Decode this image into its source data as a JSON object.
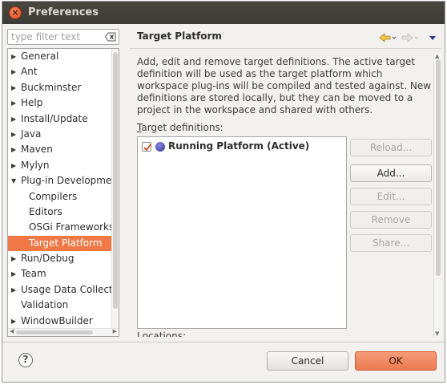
{
  "window": {
    "title": "Preferences"
  },
  "filter": {
    "placeholder": "type filter text"
  },
  "tree": {
    "items": [
      {
        "label": "General",
        "expanded": false,
        "child": false,
        "selected": false
      },
      {
        "label": "Ant",
        "expanded": false,
        "child": false,
        "selected": false
      },
      {
        "label": "Buckminster",
        "expanded": false,
        "child": false,
        "selected": false
      },
      {
        "label": "Help",
        "expanded": false,
        "child": false,
        "selected": false
      },
      {
        "label": "Install/Update",
        "expanded": false,
        "child": false,
        "selected": false
      },
      {
        "label": "Java",
        "expanded": false,
        "child": false,
        "selected": false
      },
      {
        "label": "Maven",
        "expanded": false,
        "child": false,
        "selected": false
      },
      {
        "label": "Mylyn",
        "expanded": false,
        "child": false,
        "selected": false
      },
      {
        "label": "Plug-in Developmen",
        "expanded": true,
        "child": false,
        "selected": false
      },
      {
        "label": "Compilers",
        "expanded": null,
        "child": true,
        "selected": false
      },
      {
        "label": "Editors",
        "expanded": null,
        "child": true,
        "selected": false
      },
      {
        "label": "OSGi Frameworks",
        "expanded": null,
        "child": true,
        "selected": false
      },
      {
        "label": "Target Platform",
        "expanded": null,
        "child": true,
        "selected": true
      },
      {
        "label": "Run/Debug",
        "expanded": false,
        "child": false,
        "selected": false
      },
      {
        "label": "Team",
        "expanded": false,
        "child": false,
        "selected": false
      },
      {
        "label": "Usage Data Collecto",
        "expanded": false,
        "child": false,
        "selected": false
      },
      {
        "label": "Validation",
        "expanded": null,
        "child": false,
        "selected": false
      },
      {
        "label": "WindowBuilder",
        "expanded": false,
        "child": false,
        "selected": false
      }
    ]
  },
  "page": {
    "title": "Target Platform",
    "description": "Add, edit and remove target definitions.  The active target definition will be used as the target platform which workspace plug-ins will be compiled and tested against.  New definitions are stored locally, but they can be moved to a project in the workspace and shared with others.",
    "target_definitions_label": "Target definitions:",
    "locations_label": "Locations:",
    "targets": [
      {
        "label": "Running Platform (Active)",
        "checked": true
      }
    ],
    "buttons": {
      "reload": "Reload...",
      "add": "Add...",
      "edit": "Edit...",
      "remove": "Remove",
      "share": "Share..."
    }
  },
  "footer": {
    "help": "?",
    "cancel": "Cancel",
    "ok": "OK"
  },
  "colors": {
    "accent": "#f07746",
    "titlebar": "#3c3b37",
    "ok_button": "#ec7b51"
  }
}
